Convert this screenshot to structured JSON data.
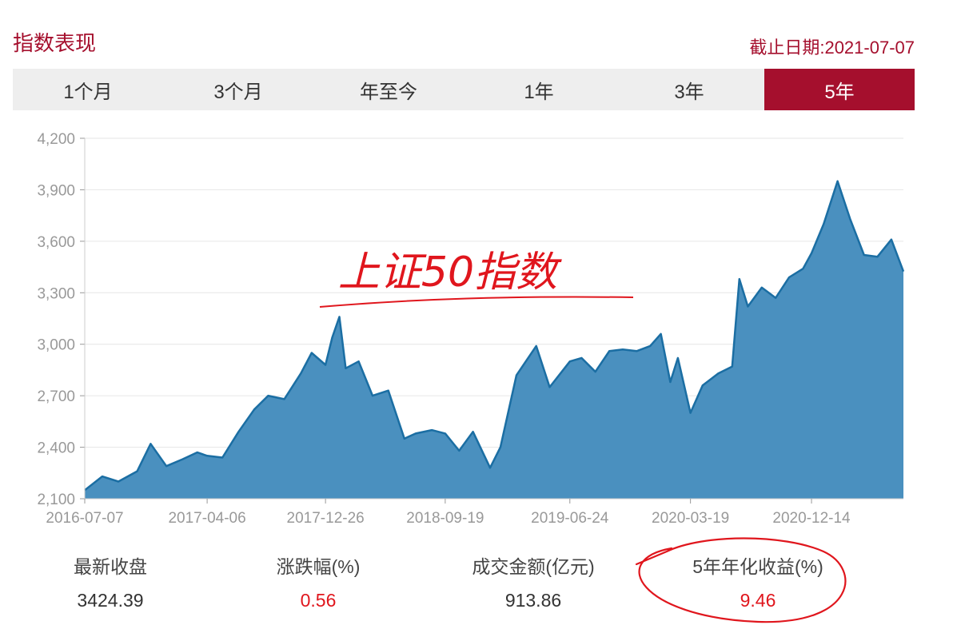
{
  "header": {
    "title": "指数表现",
    "as_of": "截止日期:2021-07-07"
  },
  "tabs": [
    {
      "label": "1个月",
      "active": false
    },
    {
      "label": "3个月",
      "active": false
    },
    {
      "label": "年至今",
      "active": false
    },
    {
      "label": "1年",
      "active": false
    },
    {
      "label": "3年",
      "active": false
    },
    {
      "label": "5年",
      "active": true
    }
  ],
  "colors": {
    "brand": "#a50f2d",
    "area_fill": "#4a90bf",
    "line": "#1b6ea3",
    "positive": "#e0161d"
  },
  "chart_data": {
    "type": "area",
    "ylim": [
      2100,
      4200
    ],
    "yticks": [
      2100,
      2400,
      2700,
      3000,
      3300,
      3600,
      3900,
      4200
    ],
    "ytick_labels": [
      "2,100",
      "2,400",
      "2,700",
      "3,000",
      "3,300",
      "3,600",
      "3,900",
      "4,200"
    ],
    "xtick_labels": [
      "2016-07-07",
      "2017-04-06",
      "2017-12-26",
      "2018-09-19",
      "2019-06-24",
      "2020-03-19",
      "2020-12-14"
    ],
    "grid": true,
    "annotation": "上证50指数",
    "x": [
      "2016-07-07",
      "2016-08-15",
      "2016-09-20",
      "2016-11-01",
      "2016-12-01",
      "2017-01-05",
      "2017-02-10",
      "2017-03-15",
      "2017-04-06",
      "2017-05-10",
      "2017-06-15",
      "2017-07-20",
      "2017-08-20",
      "2017-09-25",
      "2017-11-01",
      "2017-11-25",
      "2017-12-26",
      "2018-01-10",
      "2018-01-26",
      "2018-02-09",
      "2018-03-10",
      "2018-04-10",
      "2018-05-15",
      "2018-06-20",
      "2018-07-15",
      "2018-08-20",
      "2018-09-19",
      "2018-10-20",
      "2018-11-20",
      "2018-12-28",
      "2019-01-20",
      "2019-02-25",
      "2019-04-10",
      "2019-05-10",
      "2019-06-24",
      "2019-07-20",
      "2019-08-20",
      "2019-09-20",
      "2019-10-20",
      "2019-11-20",
      "2019-12-20",
      "2020-01-13",
      "2020-02-03",
      "2020-02-20",
      "2020-03-19",
      "2020-04-15",
      "2020-05-20",
      "2020-06-20",
      "2020-07-06",
      "2020-07-25",
      "2020-08-25",
      "2020-09-25",
      "2020-10-25",
      "2020-11-25",
      "2020-12-14",
      "2021-01-10",
      "2021-02-10",
      "2021-03-10",
      "2021-04-10",
      "2021-05-10",
      "2021-06-10",
      "2021-07-07"
    ],
    "values": [
      2150,
      2230,
      2200,
      2260,
      2420,
      2290,
      2330,
      2370,
      2350,
      2340,
      2490,
      2620,
      2700,
      2680,
      2830,
      2950,
      2880,
      3040,
      3160,
      2860,
      2900,
      2700,
      2730,
      2450,
      2480,
      2500,
      2480,
      2380,
      2490,
      2280,
      2400,
      2820,
      2990,
      2750,
      2900,
      2920,
      2840,
      2960,
      2970,
      2960,
      2990,
      3060,
      2780,
      2920,
      2600,
      2760,
      2830,
      2870,
      3380,
      3220,
      3330,
      3270,
      3390,
      3440,
      3530,
      3700,
      3950,
      3730,
      3520,
      3510,
      3610,
      3424
    ]
  },
  "stats": [
    {
      "label": "最新收盘",
      "value": "3424.39",
      "highlight": false
    },
    {
      "label": "涨跌幅(%)",
      "value": "0.56",
      "highlight": true
    },
    {
      "label": "成交金额(亿元)",
      "value": "913.86",
      "highlight": false
    },
    {
      "label": "5年年化收益(%)",
      "value": "9.46",
      "highlight": true
    }
  ]
}
